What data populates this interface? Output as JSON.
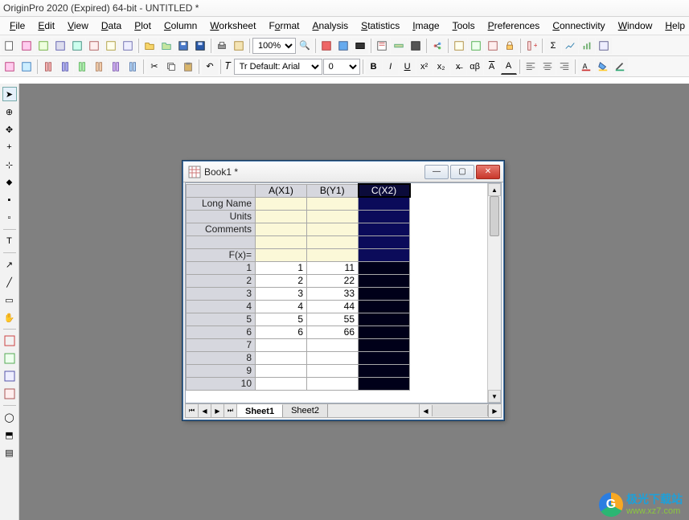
{
  "app": {
    "title": "OriginPro 2020 (Expired) 64-bit - UNTITLED *"
  },
  "menu": [
    "File",
    "Edit",
    "View",
    "Data",
    "Plot",
    "Column",
    "Worksheet",
    "Format",
    "Analysis",
    "Statistics",
    "Image",
    "Tools",
    "Preferences",
    "Connectivity",
    "Window",
    "Help"
  ],
  "menu_keys": [
    "F",
    "E",
    "V",
    "D",
    "P",
    "C",
    "W",
    "o",
    "A",
    "S",
    "I",
    "T",
    "P",
    "C",
    "W",
    "H"
  ],
  "toolbar": {
    "zoom": "100%",
    "font_label": "Tr Default: Arial",
    "font_size": "0"
  },
  "format_btns": {
    "bold": "B",
    "italic": "I",
    "underline": "U",
    "sup": "x²",
    "sub": "x₂",
    "strike": "x̶",
    "alpha": "αβ",
    "acap": "A",
    "aund": "A"
  },
  "book": {
    "title": "Book1 *",
    "columns": [
      "A(X1)",
      "B(Y1)",
      "C(X2)"
    ],
    "selected_col": 2,
    "meta_rows": [
      "Long Name",
      "Units",
      "Comments",
      "",
      "F(x)="
    ],
    "data_rows": [
      {
        "n": "1",
        "a": "1",
        "b": "11"
      },
      {
        "n": "2",
        "a": "2",
        "b": "22"
      },
      {
        "n": "3",
        "a": "3",
        "b": "33"
      },
      {
        "n": "4",
        "a": "4",
        "b": "44"
      },
      {
        "n": "5",
        "a": "5",
        "b": "55"
      },
      {
        "n": "6",
        "a": "6",
        "b": "66"
      },
      {
        "n": "7",
        "a": "",
        "b": ""
      },
      {
        "n": "8",
        "a": "",
        "b": ""
      },
      {
        "n": "9",
        "a": "",
        "b": ""
      },
      {
        "n": "10",
        "a": "",
        "b": ""
      }
    ],
    "sheets": [
      "Sheet1",
      "Sheet2"
    ],
    "active_sheet": 0
  },
  "watermark": {
    "cn": "极光下载站",
    "en": "www.xz7.com",
    "logo": "G"
  }
}
